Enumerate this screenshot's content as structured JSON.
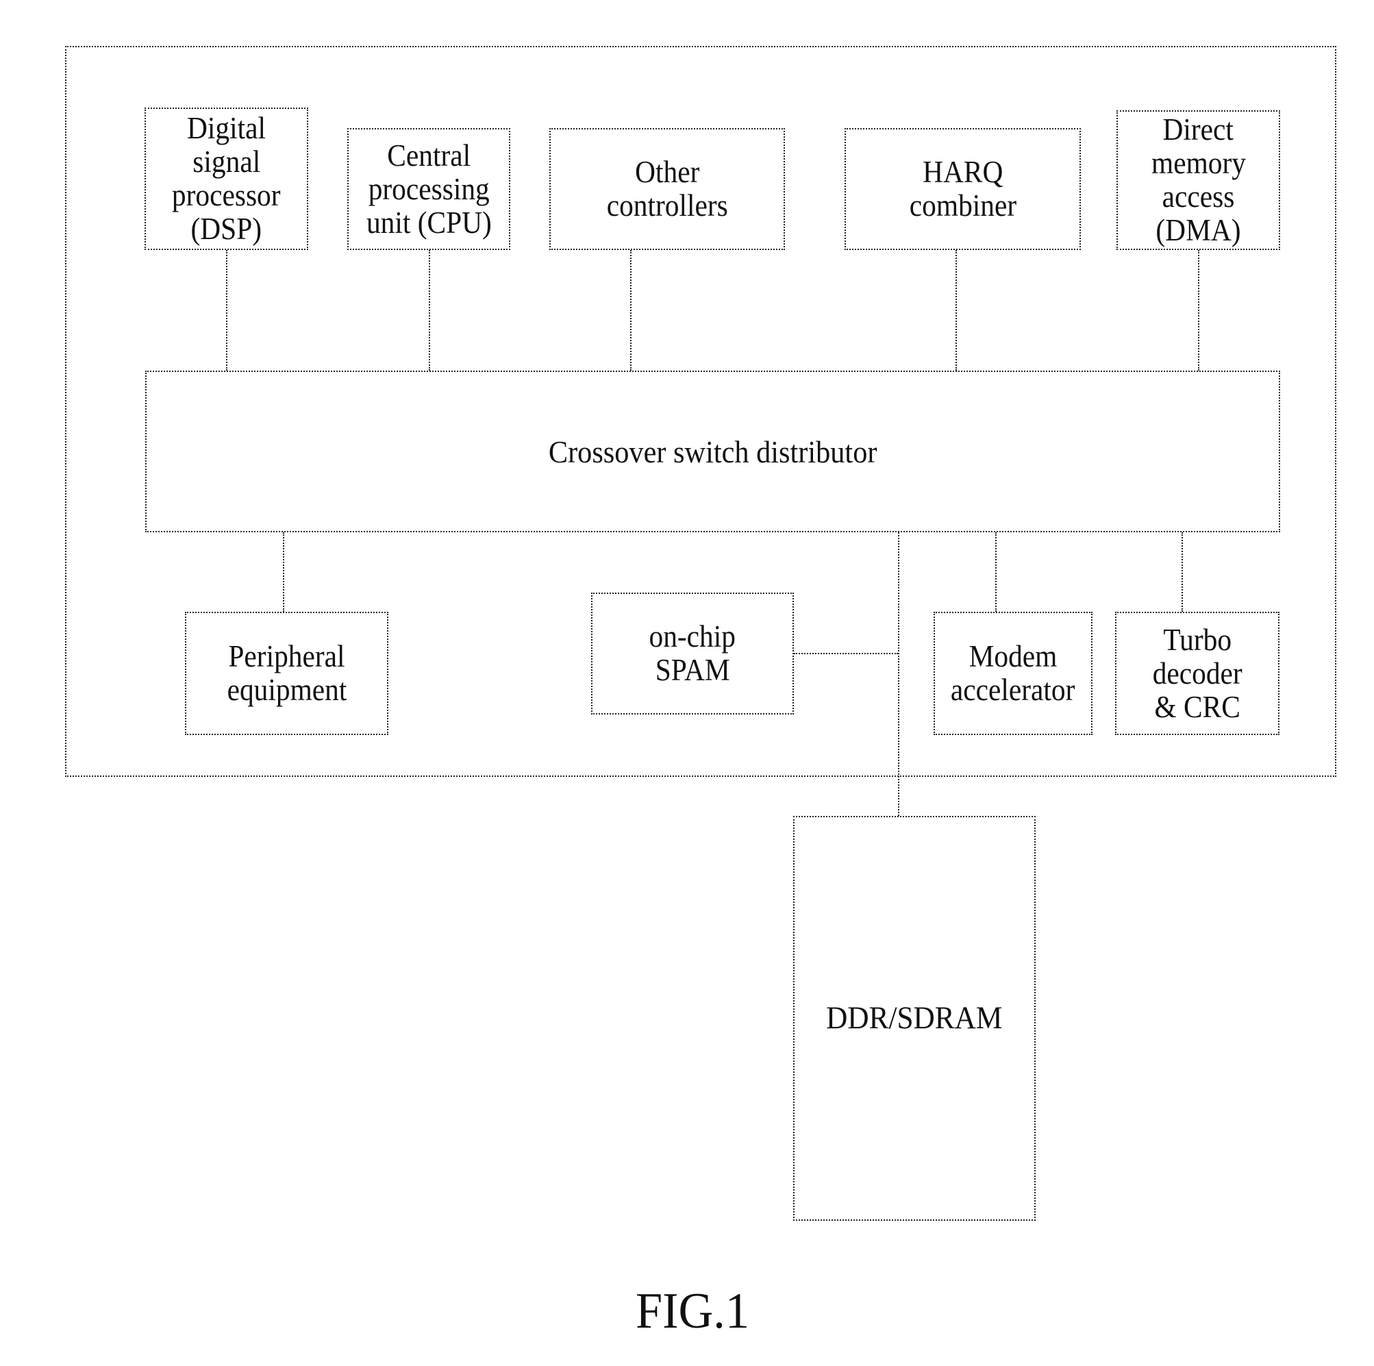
{
  "figure": {
    "caption": "FIG.1",
    "container_label": "",
    "blocks": {
      "dsp": [
        "Digital",
        "signal",
        "processor",
        "(DSP)"
      ],
      "cpu": [
        "Central",
        "processing",
        "unit (CPU)"
      ],
      "other_controllers": [
        "Other",
        "controllers"
      ],
      "harq": [
        "HARQ",
        "combiner"
      ],
      "dma": [
        "Direct",
        "memory",
        "access",
        "(DMA)"
      ],
      "crossover": [
        "Crossover switch distributor"
      ],
      "peripheral": [
        "Peripheral",
        "equipment"
      ],
      "sram": [
        "on-chip",
        "SPAM"
      ],
      "modem": [
        "Modem",
        "accelerator"
      ],
      "turbo": [
        "Turbo",
        "decoder",
        "& CRC"
      ],
      "ddr": [
        "DDR/SDRAM"
      ]
    },
    "connections": [
      {
        "from": "dsp",
        "to": "crossover"
      },
      {
        "from": "cpu",
        "to": "crossover"
      },
      {
        "from": "other_controllers",
        "to": "crossover"
      },
      {
        "from": "harq",
        "to": "crossover"
      },
      {
        "from": "dma",
        "to": "crossover"
      },
      {
        "from": "crossover",
        "to": "peripheral"
      },
      {
        "from": "crossover",
        "to": "modem"
      },
      {
        "from": "crossover",
        "to": "turbo"
      },
      {
        "from": "crossover",
        "to": "ddr"
      },
      {
        "from": "sram",
        "to": "crossover-ddr-bus"
      }
    ],
    "line_style": "dotted",
    "line_color": "#222222",
    "background": "#ffffff"
  }
}
